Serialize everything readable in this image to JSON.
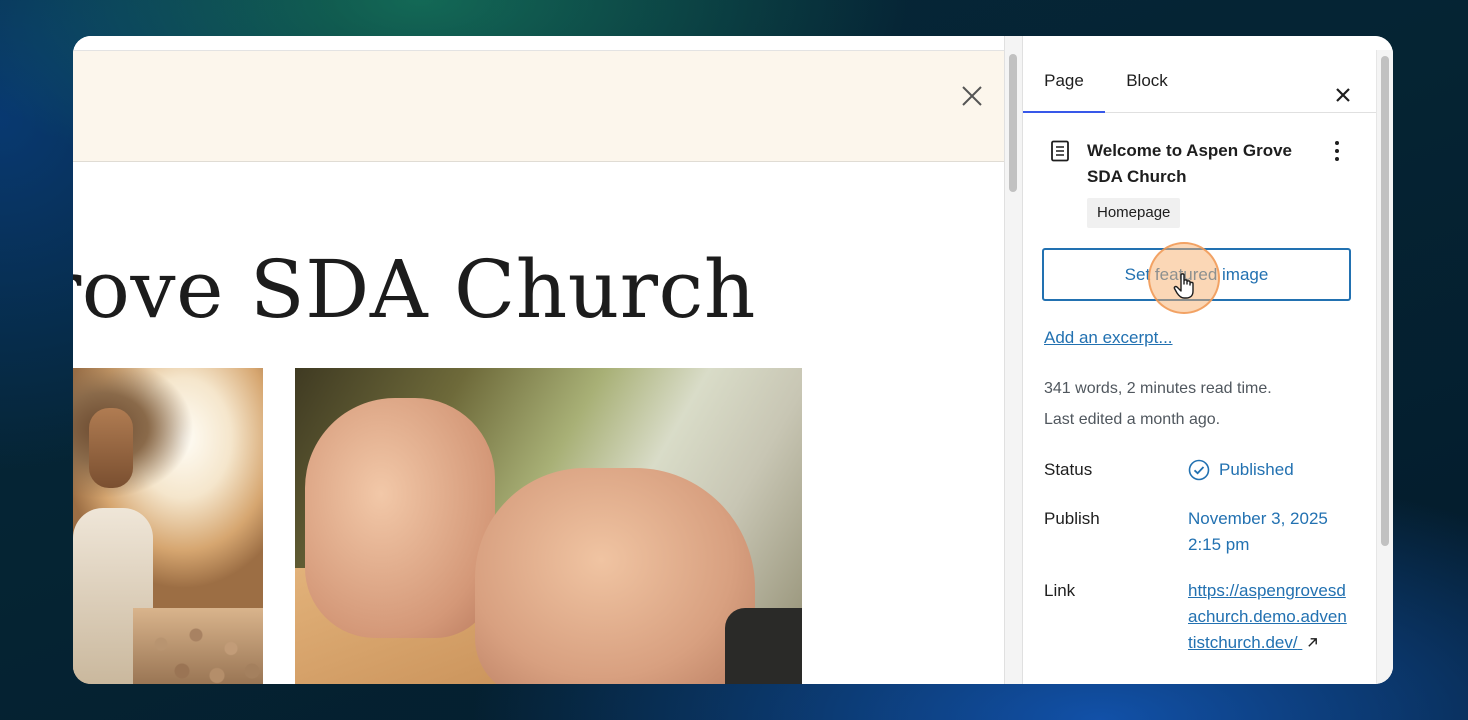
{
  "canvas": {
    "headline": "rove SDA Church",
    "close_icon": "close-icon",
    "images": [
      "jesus-crowd-image",
      "praying-hands-image"
    ]
  },
  "sidebar": {
    "tabs": [
      {
        "label": "Page",
        "active": true
      },
      {
        "label": "Block",
        "active": false
      }
    ],
    "close_icon": "close-icon",
    "page_icon": "document-icon",
    "page_title": "Welcome to Aspen Grove SDA Church",
    "more_icon": "more-vertical-icon",
    "badge": "Homepage",
    "featured_image_button": "Set featured image",
    "excerpt_link": "Add an excerpt...",
    "stats_words": "341 words, 2 minutes read time.",
    "stats_edited": "Last edited a month ago.",
    "status_label": "Status",
    "status_value": "Published",
    "publish_label": "Publish",
    "publish_date": "November 3, 2025",
    "publish_time": "2:15 pm",
    "link_label": "Link",
    "link_value": "https://aspengrovesdachurch.demo.adventistchurch.dev/",
    "link_icon": "external-link-icon"
  },
  "colors": {
    "accent": "#2271b1",
    "tab_indicator": "#3858e9",
    "banner": "#fcf6ec",
    "cursor_highlight": "#f8af6e"
  }
}
